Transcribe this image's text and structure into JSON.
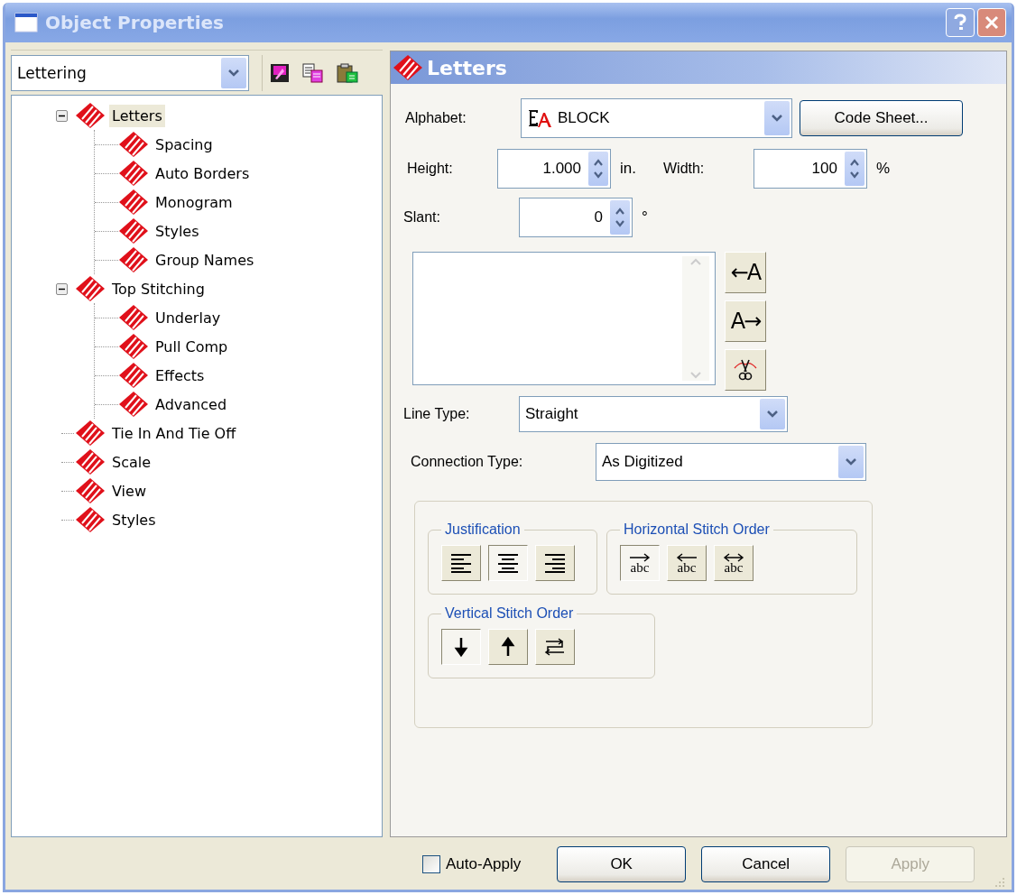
{
  "window": {
    "title": "Object Properties"
  },
  "category_dropdown": {
    "value": "Lettering"
  },
  "tree": [
    {
      "label": "Letters",
      "selected": true,
      "expanded": true,
      "children": [
        {
          "label": "Spacing",
          "selected": false
        },
        {
          "label": "Auto Borders",
          "selected": false
        },
        {
          "label": "Monogram",
          "selected": false
        },
        {
          "label": "Styles",
          "selected": false
        },
        {
          "label": "Group Names",
          "selected": false
        }
      ]
    },
    {
      "label": "Top Stitching",
      "selected": false,
      "expanded": true,
      "children": [
        {
          "label": "Underlay",
          "selected": false
        },
        {
          "label": "Pull Comp",
          "selected": false
        },
        {
          "label": "Effects",
          "selected": false
        },
        {
          "label": "Advanced",
          "selected": false
        }
      ]
    },
    {
      "label": "Tie In And Tie Off",
      "selected": false
    },
    {
      "label": "Scale",
      "selected": false
    },
    {
      "label": "View",
      "selected": false
    },
    {
      "label": "Styles",
      "selected": false
    }
  ],
  "panel": {
    "title": "Letters"
  },
  "alphabet": {
    "label": "Alphabet:",
    "value": "BLOCK",
    "button": "Code Sheet..."
  },
  "height": {
    "label": "Height:",
    "value": "1.000",
    "unit": "in."
  },
  "width": {
    "label": "Width:",
    "value": "100",
    "unit": "%"
  },
  "slant": {
    "label": "Slant:",
    "value": "0",
    "unit": "°"
  },
  "text_buttons": [
    {
      "kind": "prepend",
      "label": "←A"
    },
    {
      "kind": "append",
      "label": "A→"
    },
    {
      "kind": "cut"
    }
  ],
  "line_type": {
    "label": "Line Type:",
    "value": "Straight"
  },
  "connection_type": {
    "label": "Connection Type:",
    "value": "As Digitized"
  },
  "justification": {
    "title": "Justification",
    "options": [
      {
        "kind": "left",
        "selected": false
      },
      {
        "kind": "center",
        "selected": true
      },
      {
        "kind": "right",
        "selected": false
      }
    ]
  },
  "horizontal_stitch_order": {
    "title": "Horizontal Stitch Order",
    "options": [
      {
        "kind": "ltr",
        "label": "abc",
        "selected": true
      },
      {
        "kind": "rtl",
        "label": "abc",
        "selected": false
      },
      {
        "kind": "both",
        "label": "abc",
        "selected": false
      }
    ]
  },
  "vertical_stitch_order": {
    "title": "Vertical Stitch Order",
    "options": [
      {
        "kind": "down",
        "selected": true
      },
      {
        "kind": "up",
        "selected": false
      },
      {
        "kind": "alternate",
        "selected": false
      }
    ]
  },
  "auto_apply": {
    "label": "Auto-Apply",
    "checked": false
  },
  "buttons": [
    {
      "label": "OK",
      "disabled": false
    },
    {
      "label": "Cancel",
      "disabled": false
    },
    {
      "label": "Apply",
      "disabled": true
    }
  ]
}
